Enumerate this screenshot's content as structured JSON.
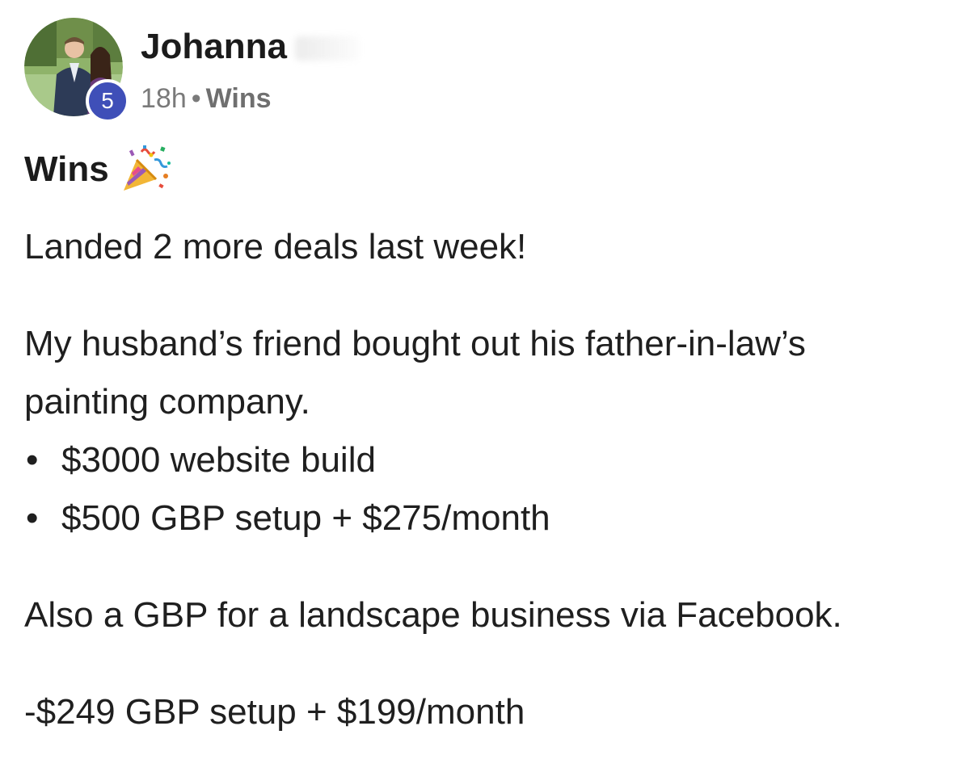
{
  "author": {
    "name": "Johanna",
    "level": "5"
  },
  "meta": {
    "time": "18h",
    "separator": "•",
    "category": "Wins"
  },
  "post": {
    "title": "Wins",
    "title_icon": "party-popper-icon",
    "line1": "Landed 2 more deals last week!",
    "line2": "My husband’s friend bought out his father-in-law’s painting company.",
    "bullets": [
      "$3000 website build",
      "$500 GBP setup + $275/month"
    ],
    "bullet_char": "•",
    "line3": "Also a GBP for a landscape business via Facebook.",
    "line4": "-$249 GBP setup + $199/month"
  },
  "colors": {
    "badge": "#3f4fb8",
    "meta_text": "#7a7a7a"
  }
}
